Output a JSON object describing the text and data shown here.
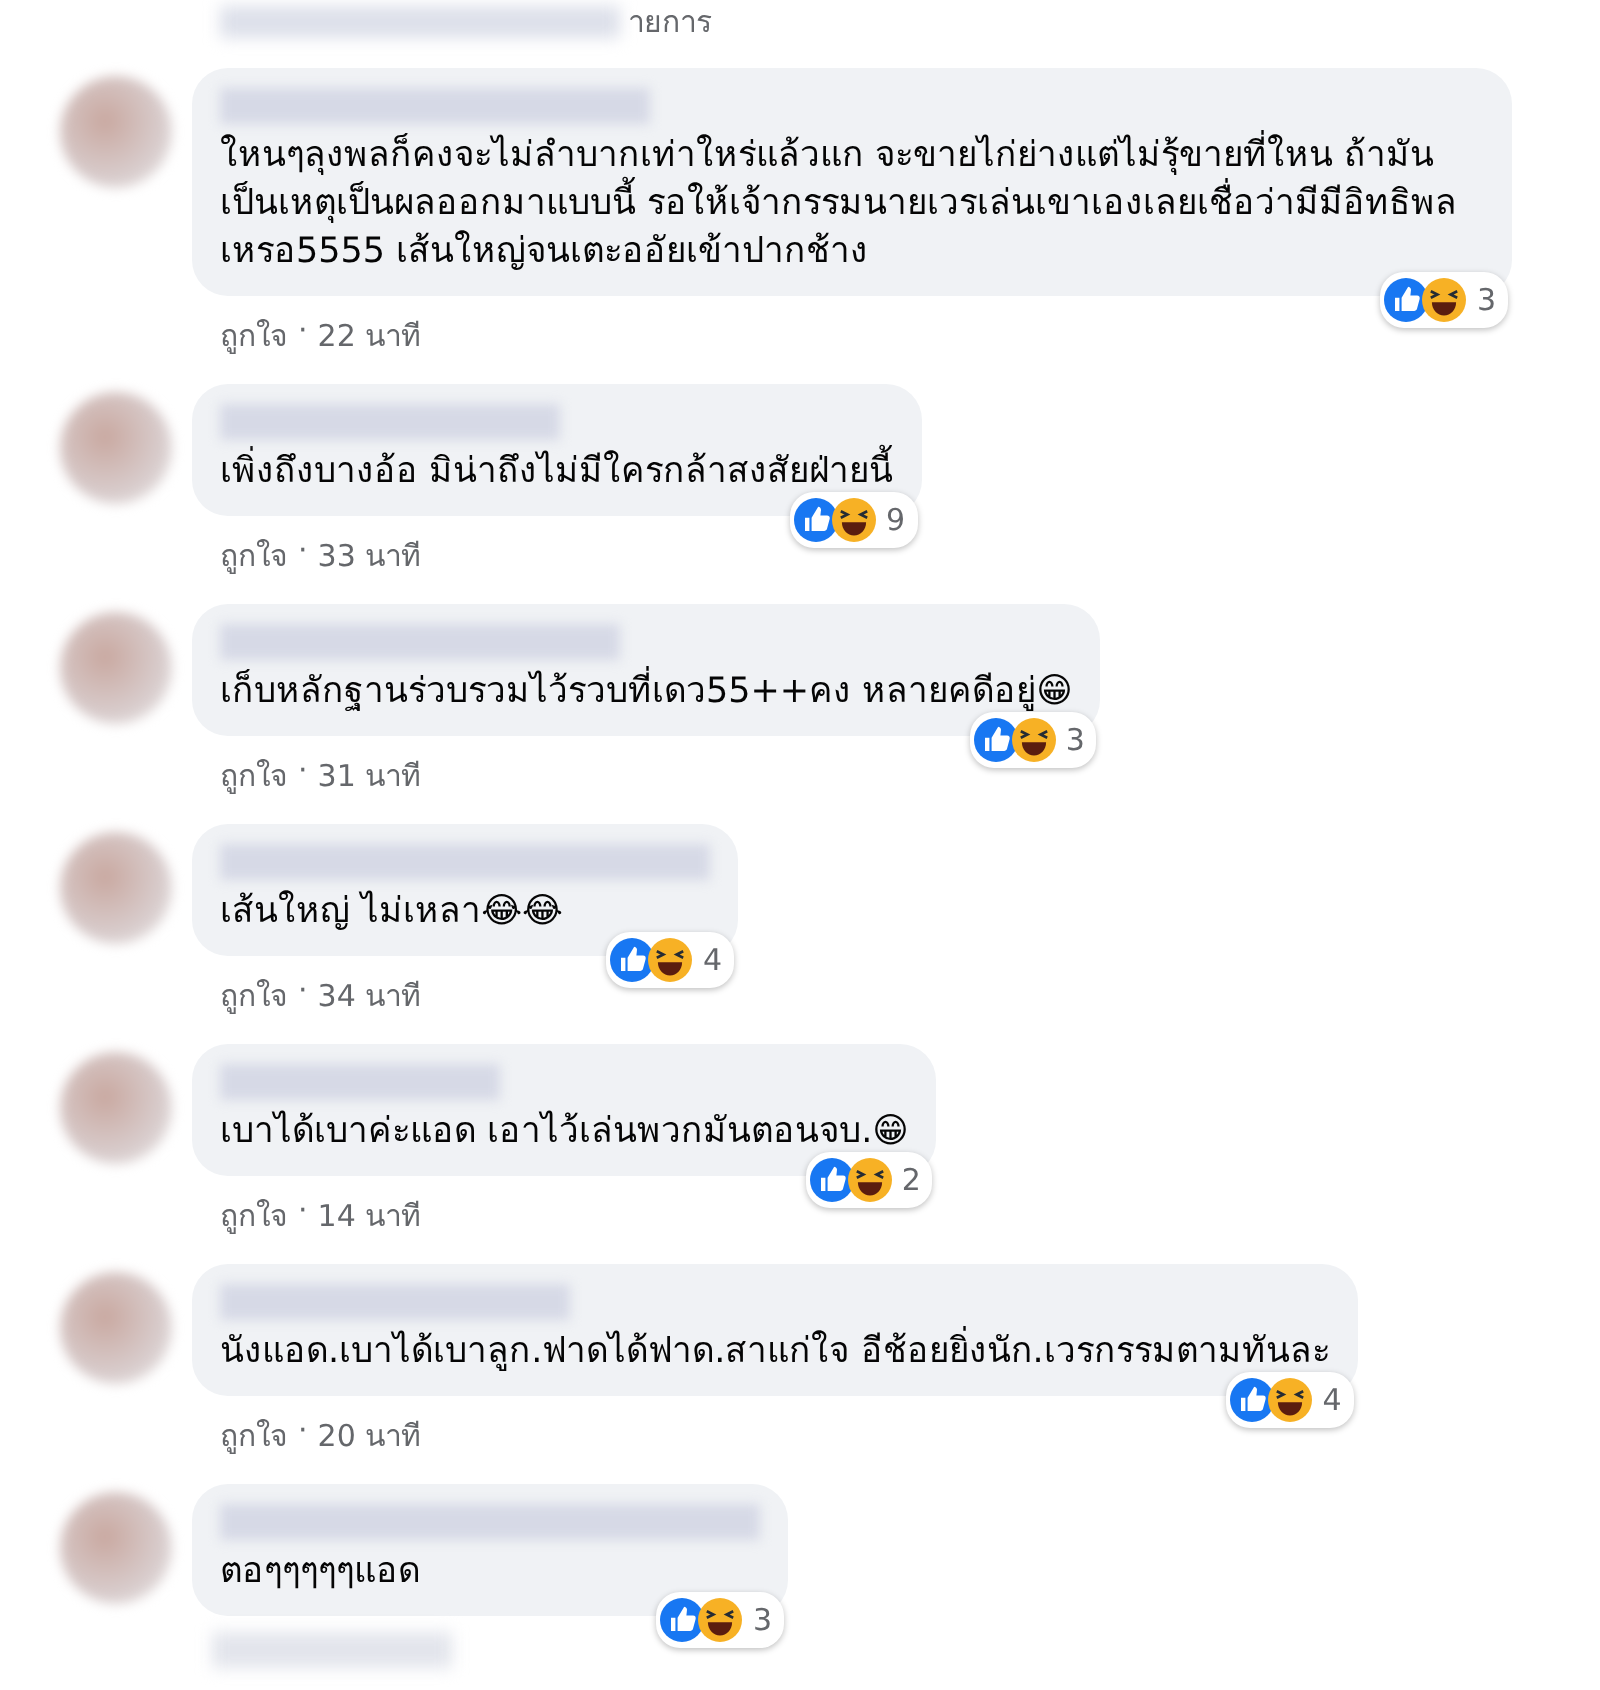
{
  "top_fragment": "ายการ",
  "comments": [
    {
      "text": "ใหนๆลุงพลก็คงจะไม่ลำบากเท่าใหร่แล้วแก จะขายไก่ย่างแต่ไม่รุ้ขายที่ใหน ถ้ามันเป็นเหตุเป็นผลออกมาแบบนี้ รอให้เจ้ากรรมนายเวรเล่นเขาเองเลยเชื่อว่ามีมีอิทธิพลเหรอ5555 เส้นใหญ่จนเตะออัยเข้าปากช้าง",
      "reactions": [
        {
          "kind": "like"
        },
        {
          "kind": "haha"
        }
      ],
      "count": "3",
      "like": "ถูกใจ",
      "separator": "·",
      "time": "22 นาที"
    },
    {
      "text": "เพิ่งถึงบางอ้อ มิน่าถึงไม่มีใครกล้าสงสัยฝ่ายนี้",
      "reactions": [
        {
          "kind": "like"
        },
        {
          "kind": "haha"
        }
      ],
      "count": "9",
      "like": "ถูกใจ",
      "separator": "·",
      "time": "33 นาที"
    },
    {
      "text": "เก็บหลักฐานร่วบรวมไว้รวบที่เดว55++คง หลายคดีอยู่😁",
      "reactions": [
        {
          "kind": "like"
        },
        {
          "kind": "haha"
        }
      ],
      "count": "3",
      "like": "ถูกใจ",
      "separator": "·",
      "time": "31 นาที"
    },
    {
      "text": "เส้นใหญ่ ไม่เหลา😂😂",
      "reactions": [
        {
          "kind": "like"
        },
        {
          "kind": "haha"
        }
      ],
      "count": "4",
      "like": "ถูกใจ",
      "separator": "·",
      "time": "34 นาที"
    },
    {
      "text": "เบาได้เบาค่ะแอด เอาไว้เล่นพวกมันตอนจบ.😁",
      "reactions": [
        {
          "kind": "like"
        },
        {
          "kind": "haha"
        }
      ],
      "count": "2",
      "like": "ถูกใจ",
      "separator": "·",
      "time": "14 นาที"
    },
    {
      "text": "นังแอด.เบาได้เบาลูก.ฟาดได้ฟาด.สาแก่ใจ อีช้อยยิ่งนัก.เวรกรรมตามทันละ",
      "reactions": [
        {
          "kind": "like"
        },
        {
          "kind": "haha"
        }
      ],
      "count": "4",
      "like": "ถูกใจ",
      "separator": "·",
      "time": "20 นาที"
    },
    {
      "text": "ตอๆๆๆๆๆแอด",
      "reactions": [
        {
          "kind": "like"
        },
        {
          "kind": "haha"
        }
      ],
      "count": "3"
    }
  ]
}
